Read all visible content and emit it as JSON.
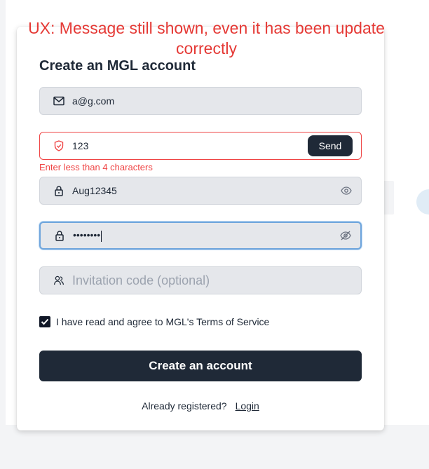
{
  "annotation": {
    "line1": "UX: Message still shown, even it has been update",
    "line2": "correctly",
    "color": "#e53935"
  },
  "form": {
    "title": "Create an MGL account",
    "email": {
      "value": "a@g.com",
      "icon": "mail-icon"
    },
    "verification_code": {
      "value": "123",
      "icon": "shield-icon",
      "send_label": "Send"
    },
    "error_message": "Enter less than 4 characters",
    "password": {
      "value": "Aug12345",
      "icon": "lock-icon",
      "toggle_icon": "eye-icon"
    },
    "confirm_password": {
      "value": "••••••••",
      "icon": "lock-icon",
      "toggle_icon": "eye-slash-icon"
    },
    "invitation_code": {
      "placeholder": "Invitation code (optional)",
      "icon": "user-group-icon"
    },
    "terms": {
      "checked": true,
      "label": "I have read and agree to MGL's Terms of Service"
    },
    "submit_label": "Create an account",
    "footer": {
      "prompt": "Already registered?",
      "login_label": "Login"
    }
  },
  "colors": {
    "primary": "#1f2937",
    "error": "#ef4444",
    "focus_border": "#6fa5dc",
    "field_bg": "#e5e7eb"
  }
}
